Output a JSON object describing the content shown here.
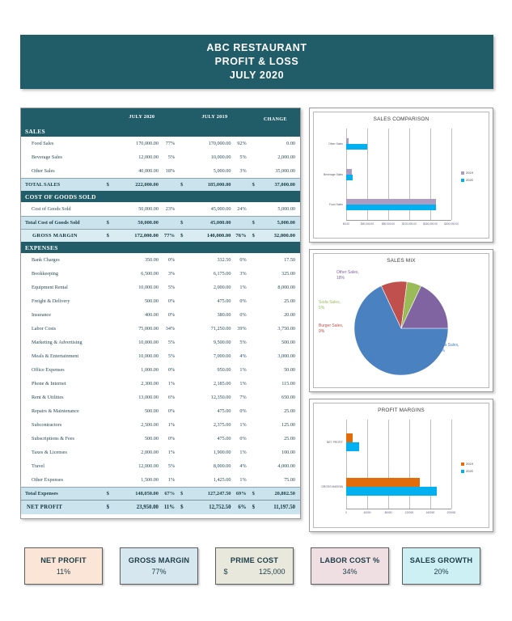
{
  "banner": {
    "line1": "ABC RESTAURANT",
    "line2": "PROFIT & LOSS",
    "line3": "JULY 2020",
    "bg": "#215c69"
  },
  "pl_table": {
    "columns": {
      "year_current": "JULY 2020",
      "year_prior": "JULY 2019",
      "change": "CHANGE"
    },
    "sections": [
      {
        "title": "SALES",
        "rows": [
          {
            "label": "Food Sales",
            "cur_amt": "170,000.00",
            "cur_pct": "77%",
            "pri_amt": "170,000.00",
            "pri_pct": "92%",
            "chg_amt": "0.00"
          },
          {
            "label": "Beverage Sales",
            "cur_amt": "12,000.00",
            "cur_pct": "5%",
            "pri_amt": "10,000.00",
            "pri_pct": "5%",
            "chg_amt": "2,000.00"
          },
          {
            "label": "Other Sales",
            "cur_amt": "40,000.00",
            "cur_pct": "18%",
            "pri_amt": "5,000.00",
            "pri_pct": "3%",
            "chg_amt": "35,000.00"
          }
        ],
        "total": {
          "label": "TOTAL SALES",
          "cur_sym": "$",
          "cur_amt": "222,000.00",
          "cur_pct": "",
          "pri_sym": "$",
          "pri_amt": "185,000.00",
          "pri_pct": "",
          "chg_sym": "$",
          "chg_amt": "37,000.00"
        }
      },
      {
        "title": "COST OF GOODS SOLD",
        "rows": [
          {
            "label": "Cost of Goods Sold",
            "cur_amt": "50,000.00",
            "cur_pct": "23%",
            "pri_amt": "45,000.00",
            "pri_pct": "24%",
            "chg_amt": "5,000.00"
          }
        ],
        "total": {
          "label": "Total Cost of Goods Sold",
          "cur_sym": "$",
          "cur_amt": "50,000.00",
          "cur_pct": "",
          "pri_sym": "$",
          "pri_amt": "45,000.00",
          "pri_pct": "",
          "chg_sym": "$",
          "chg_amt": "5,000.00"
        }
      }
    ],
    "gross_margin": {
      "label": "GROSS MARGIN",
      "cur_sym": "$",
      "cur_amt": "172,000.00",
      "cur_pct": "77%",
      "pri_sym": "$",
      "pri_amt": "140,000.00",
      "pri_pct": "76%",
      "chg_sym": "$",
      "chg_amt": "32,000.00"
    },
    "expenses": {
      "title": "EXPENSES",
      "rows": [
        {
          "label": "Bank Charges",
          "cur_amt": "350.00",
          "cur_pct": "0%",
          "pri_amt": "332.50",
          "pri_pct": "0%",
          "chg_amt": "17.50"
        },
        {
          "label": "Bookkeeping",
          "cur_amt": "6,500.00",
          "cur_pct": "3%",
          "pri_amt": "6,175.00",
          "pri_pct": "3%",
          "chg_amt": "325.00"
        },
        {
          "label": "Equipment Rental",
          "cur_amt": "10,000.00",
          "cur_pct": "5%",
          "pri_amt": "2,000.00",
          "pri_pct": "1%",
          "chg_amt": "8,000.00"
        },
        {
          "label": "Freight & Delivery",
          "cur_amt": "500.00",
          "cur_pct": "0%",
          "pri_amt": "475.00",
          "pri_pct": "0%",
          "chg_amt": "25.00"
        },
        {
          "label": "Insurance",
          "cur_amt": "400.00",
          "cur_pct": "0%",
          "pri_amt": "380.00",
          "pri_pct": "0%",
          "chg_amt": "20.00"
        },
        {
          "label": "Labor Costs",
          "cur_amt": "75,000.00",
          "cur_pct": "34%",
          "pri_amt": "71,250.00",
          "pri_pct": "39%",
          "chg_amt": "3,750.00"
        },
        {
          "label": "Marketing & Advertising",
          "cur_amt": "10,000.00",
          "cur_pct": "5%",
          "pri_amt": "9,500.00",
          "pri_pct": "5%",
          "chg_amt": "500.00"
        },
        {
          "label": "Meals & Entertainment",
          "cur_amt": "10,000.00",
          "cur_pct": "5%",
          "pri_amt": "7,000.00",
          "pri_pct": "4%",
          "chg_amt": "3,000.00"
        },
        {
          "label": "Office Expenses",
          "cur_amt": "1,000.00",
          "cur_pct": "0%",
          "pri_amt": "950.00",
          "pri_pct": "1%",
          "chg_amt": "50.00"
        },
        {
          "label": "Phone & Internet",
          "cur_amt": "2,300.00",
          "cur_pct": "1%",
          "pri_amt": "2,185.00",
          "pri_pct": "1%",
          "chg_amt": "115.00"
        },
        {
          "label": "Rent & Utilities",
          "cur_amt": "13,000.00",
          "cur_pct": "6%",
          "pri_amt": "12,350.00",
          "pri_pct": "7%",
          "chg_amt": "650.00"
        },
        {
          "label": "Repairs & Maintenance",
          "cur_amt": "500.00",
          "cur_pct": "0%",
          "pri_amt": "475.00",
          "pri_pct": "0%",
          "chg_amt": "25.00"
        },
        {
          "label": "Subcontractors",
          "cur_amt": "2,500.00",
          "cur_pct": "1%",
          "pri_amt": "2,375.00",
          "pri_pct": "1%",
          "chg_amt": "125.00"
        },
        {
          "label": "Subscriptions & Fees",
          "cur_amt": "500.00",
          "cur_pct": "0%",
          "pri_amt": "475.00",
          "pri_pct": "0%",
          "chg_amt": "25.00"
        },
        {
          "label": "Taxes & Licenses",
          "cur_amt": "2,000.00",
          "cur_pct": "1%",
          "pri_amt": "1,900.00",
          "pri_pct": "1%",
          "chg_amt": "100.00"
        },
        {
          "label": "Travel",
          "cur_amt": "12,000.00",
          "cur_pct": "5%",
          "pri_amt": "8,000.00",
          "pri_pct": "4%",
          "chg_amt": "4,000.00"
        },
        {
          "label": "Other Expenses",
          "cur_amt": "1,500.00",
          "cur_pct": "1%",
          "pri_amt": "1,425.00",
          "pri_pct": "1%",
          "chg_amt": "75.00"
        }
      ],
      "total": {
        "label": "Total Expenses",
        "cur_sym": "$",
        "cur_amt": "148,050.00",
        "cur_pct": "67%",
        "pri_sym": "$",
        "pri_amt": "127,247.50",
        "pri_pct": "69%",
        "chg_sym": "$",
        "chg_amt": "20,802.50"
      }
    },
    "net_profit": {
      "label": "NET PROFIT",
      "cur_sym": "$",
      "cur_amt": "23,950.00",
      "cur_pct": "11%",
      "pri_sym": "$",
      "pri_amt": "12,752.50",
      "pri_pct": "6%",
      "chg_sym": "$",
      "chg_amt": "11,197.50"
    }
  },
  "chart_data": [
    {
      "type": "bar",
      "orientation": "horizontal",
      "title": "SALES COMPARISON",
      "categories": [
        "Other Sales",
        "Beverage Sales",
        "Food Sales"
      ],
      "series": [
        {
          "name": "2019",
          "values": [
            5000,
            10000,
            170000
          ],
          "color": "#ac9bc0"
        },
        {
          "name": "2020",
          "values": [
            40000,
            12000,
            170000
          ],
          "color": "#00b0f0"
        }
      ],
      "xlabel": "",
      "ylabel": "",
      "xlim": [
        0,
        200000
      ],
      "xticks": [
        "$0.00",
        "$40,000.00",
        "$80,000.00",
        "$120,000.00",
        "$160,000.00",
        "$200,000.00"
      ],
      "grid": true,
      "legend_position": "right"
    },
    {
      "type": "pie",
      "title": "SALES MIX",
      "labels": [
        "Pizza Sales",
        "Burger Sales",
        "Soda Sales",
        "Other Sales"
      ],
      "values": [
        68,
        9,
        5,
        18
      ],
      "value_labels": [
        "Pizza Sales, 68%",
        "Burger Sales, 9%",
        "Soda Sales, 5%",
        "Other Sales, 18%"
      ],
      "colors": [
        "#4a81c0",
        "#c0504d",
        "#9bbb59",
        "#8064a2"
      ],
      "legend_position": "none"
    },
    {
      "type": "bar",
      "orientation": "horizontal",
      "title": "PROFIT MARGINS",
      "categories": [
        "NET PROFIT",
        "GROSS MARGIN"
      ],
      "series": [
        {
          "name": "2019",
          "values": [
            12752.5,
            140000
          ],
          "color": "#e36c0a"
        },
        {
          "name": "2020",
          "values": [
            23950,
            172000
          ],
          "color": "#00b0f0"
        }
      ],
      "xlabel": "",
      "ylabel": "",
      "xlim": [
        0,
        200000
      ],
      "xticks": [
        "0",
        "40000",
        "80000",
        "120000",
        "160000",
        "200000"
      ],
      "grid": true,
      "legend_position": "right"
    }
  ],
  "kpis": [
    {
      "label": "NET PROFIT",
      "value": "11%",
      "symbol": "",
      "bg": "#fbe5d6",
      "text": "#1d3d47"
    },
    {
      "label": "GROSS MARGIN",
      "value": "77%",
      "symbol": "",
      "bg": "#d6e7ef",
      "text": "#1d3d47"
    },
    {
      "label": "PRIME COST",
      "value": "125,000",
      "symbol": "$",
      "bg": "#e8e8dc",
      "text": "#1d3d47"
    },
    {
      "label": "LABOR COST %",
      "value": "34%",
      "symbol": "",
      "bg": "#f0dfe2",
      "text": "#1d3d47"
    },
    {
      "label": "SALES GROWTH",
      "value": "20%",
      "symbol": "",
      "bg": "#cdf0f5",
      "text": "#1d3d47"
    }
  ]
}
